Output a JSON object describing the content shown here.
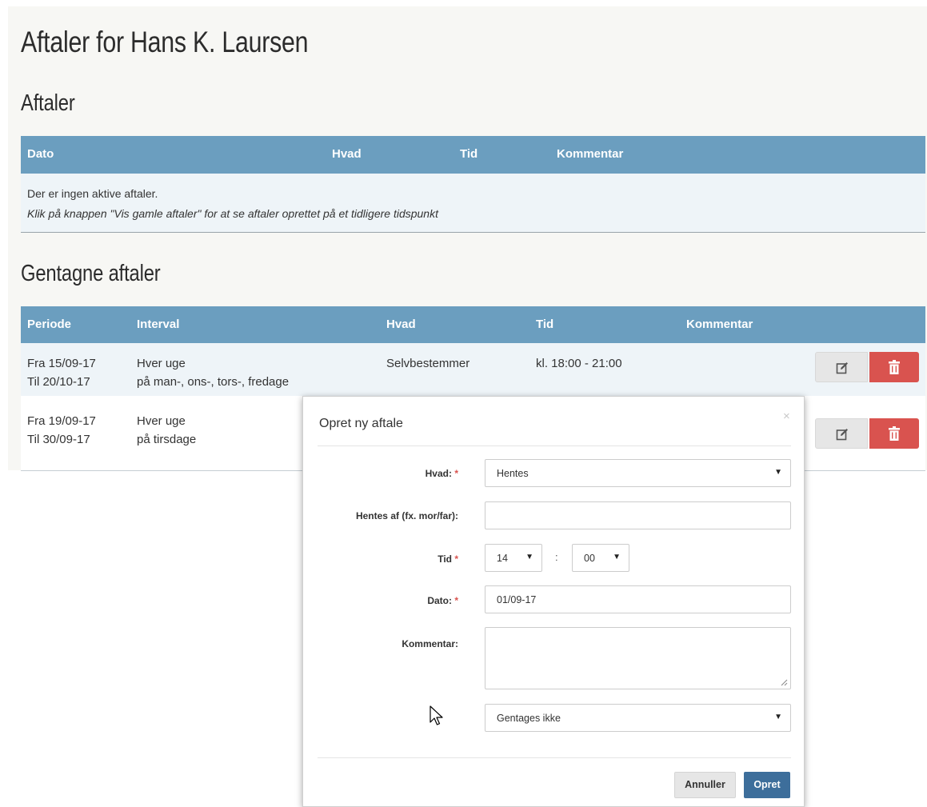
{
  "page": {
    "title": "Aftaler for Hans K. Laursen"
  },
  "appointments": {
    "heading": "Aftaler",
    "columns": [
      "Dato",
      "Hvad",
      "Tid",
      "Kommentar"
    ],
    "empty_text": "Der er ingen aktive aftaler.",
    "hint_text": "Klik på knappen \"Vis gamle aftaler\" for at se aftaler oprettet på et tidligere tidspunkt"
  },
  "recurring": {
    "heading": "Gentagne aftaler",
    "columns": [
      "Periode",
      "Interval",
      "Hvad",
      "Tid",
      "Kommentar"
    ],
    "rows": [
      {
        "from": "Fra 15/09-17",
        "to": "Til 20/10-17",
        "interval": "Hver uge",
        "days": "på man-, ons-, tors-, fredage",
        "what": "Selvbestemmer",
        "time": "kl. 18:00 - 21:00",
        "comment": ""
      },
      {
        "from": "Fra 19/09-17",
        "to": "Til 30/09-17",
        "interval": "Hver uge",
        "days": "på tirsdage",
        "what": "",
        "time": "",
        "comment": ""
      }
    ]
  },
  "modal": {
    "title": "Opret ny aftale",
    "close": "×",
    "hvad_label": "Hvad:",
    "hvad_value": "Hentes",
    "hentes_label": "Hentes af (fx. mor/far):",
    "hentes_value": "",
    "tid_label": "Tid",
    "tid_hour": "14",
    "tid_minute": "00",
    "tid_separator": ":",
    "dato_label": "Dato:",
    "dato_value": "01/09-17",
    "kommentar_label": "Kommentar:",
    "kommentar_value": "",
    "repeat_value": "Gentages ikke",
    "required_mark": "*",
    "cancel_label": "Annuller",
    "submit_label": "Opret"
  },
  "colors": {
    "header_blue": "#6b9ebf",
    "delete_red": "#d9534f",
    "primary_blue": "#3d6e9b"
  }
}
